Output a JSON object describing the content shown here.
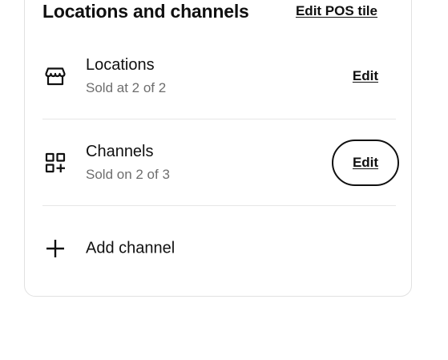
{
  "card": {
    "title": "Locations and channels",
    "edit_pos_tile_label": "Edit POS tile"
  },
  "rows": [
    {
      "label": "Locations",
      "sub": "Sold at 2 of 2",
      "edit_label": "Edit",
      "icon": "storefront-icon"
    },
    {
      "label": "Channels",
      "sub": "Sold on 2 of 3",
      "edit_label": "Edit",
      "icon": "grid-plus-icon"
    }
  ],
  "add_channel": {
    "label": "Add channel",
    "icon": "plus-icon"
  },
  "colors": {
    "text": "#101010",
    "secondary_text": "#6e6e6e",
    "border": "#e1e1e1"
  }
}
